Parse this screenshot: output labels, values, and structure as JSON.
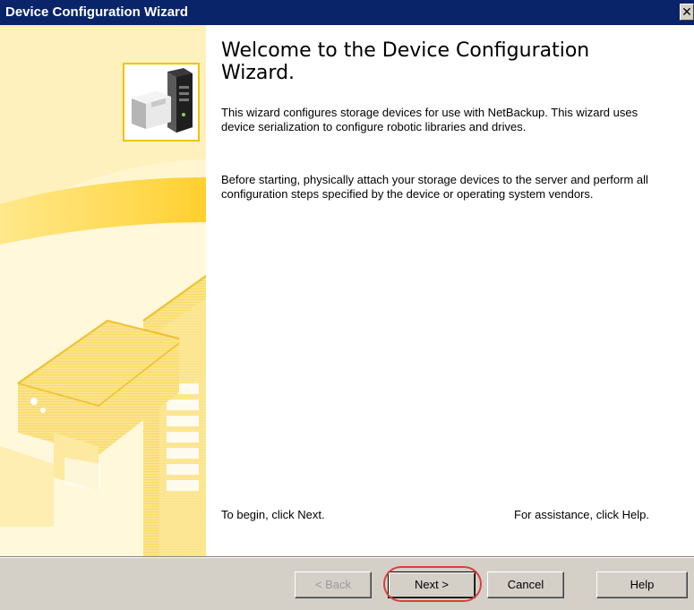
{
  "window": {
    "title": "Device Configuration Wizard",
    "close_glyph": "✕"
  },
  "content": {
    "heading": "Welcome to the Device Configuration Wizard.",
    "paragraph1": "This wizard configures storage devices for use with NetBackup. This wizard uses device serialization to configure robotic libraries and drives.",
    "paragraph2": "Before starting, physically attach your storage devices to the server and perform all configuration steps specified by the device or operating system vendors.",
    "begin_hint": "To begin, click Next.",
    "help_hint": "For assistance, click Help."
  },
  "buttons": {
    "back": "< Back",
    "next": "Next >",
    "cancel": "Cancel",
    "help": "Help"
  },
  "colors": {
    "titlebar": "#0a246a",
    "accent_yellow": "#f3c300",
    "panel_light": "#fff3c2",
    "footer": "#d4d0c8",
    "highlight": "#d9403a"
  },
  "icons": {
    "hero": "server-storage-icon",
    "close": "close-icon",
    "background_art": "server-illustration"
  }
}
